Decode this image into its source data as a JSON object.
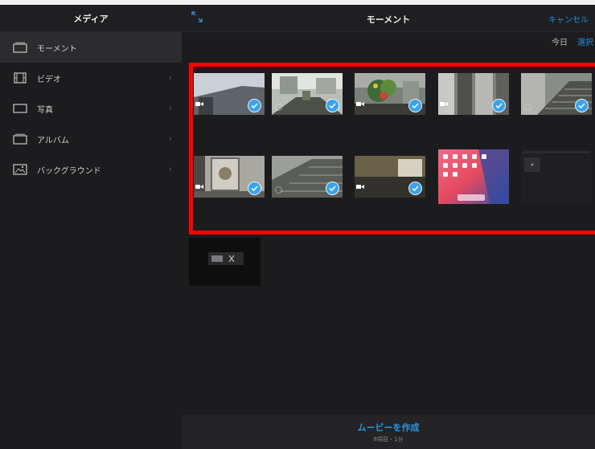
{
  "sidebar": {
    "title": "メディア",
    "items": [
      {
        "label": "モーメント",
        "icon": "moments-icon",
        "active": true,
        "chevron": false
      },
      {
        "label": "ビデオ",
        "icon": "film-icon",
        "active": false,
        "chevron": true
      },
      {
        "label": "写真",
        "icon": "photo-frame-icon",
        "active": false,
        "chevron": true
      },
      {
        "label": "アルバム",
        "icon": "album-icon",
        "active": false,
        "chevron": true
      },
      {
        "label": "バックグラウンド",
        "icon": "background-image-icon",
        "active": false,
        "chevron": true
      }
    ]
  },
  "header": {
    "title": "モーメント",
    "cancel_label": "キャンセル",
    "today_label": "今日",
    "select_label": "選択"
  },
  "thumbnails": [
    {
      "name": "thumb-corridor-video",
      "kind": "video",
      "selected": true
    },
    {
      "name": "thumb-courtyard-live",
      "kind": "live",
      "selected": true
    },
    {
      "name": "thumb-plants-video",
      "kind": "video",
      "selected": true
    },
    {
      "name": "thumb-doorway-video",
      "kind": "video",
      "selected": true
    },
    {
      "name": "thumb-stairs-live",
      "kind": "live",
      "selected": true
    },
    {
      "name": "thumb-wallart-video",
      "kind": "video",
      "selected": true
    },
    {
      "name": "thumb-stairs2-live",
      "kind": "live",
      "selected": true
    },
    {
      "name": "thumb-room-video",
      "kind": "video",
      "selected": true
    },
    {
      "name": "thumb-ipad-screenshot",
      "kind": "photo",
      "selected": false
    },
    {
      "name": "thumb-dark-screenshot",
      "kind": "photo",
      "selected": false
    },
    {
      "name": "thumb-dark-screenshot-2",
      "kind": "photo",
      "selected": false
    }
  ],
  "footer": {
    "make_movie_label": "ムービーを作成",
    "summary": "8項目・1分"
  },
  "colors": {
    "accent": "#2b96e2",
    "check": "#3aa3e8",
    "highlight": "#ff0000",
    "background": "#1c1c1e"
  }
}
